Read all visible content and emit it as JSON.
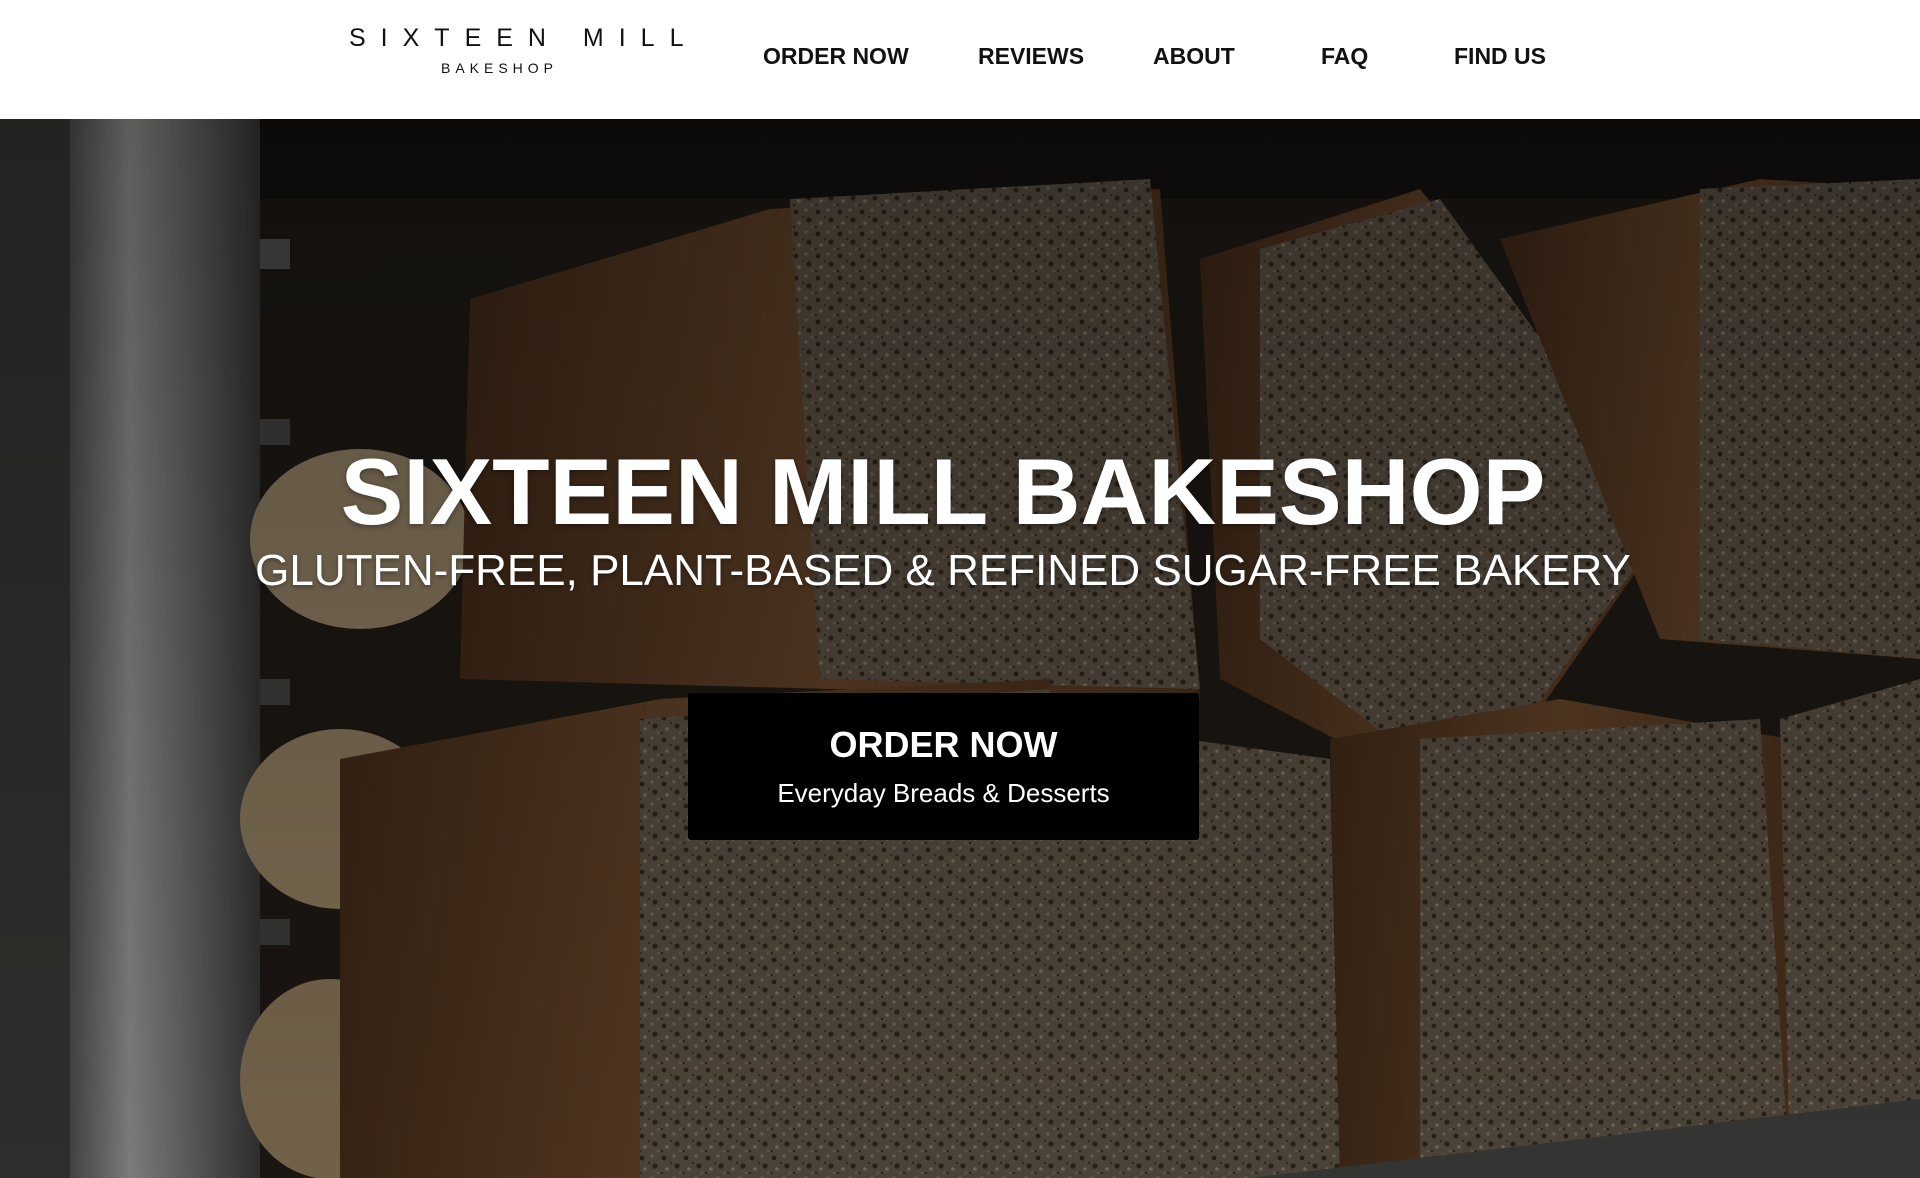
{
  "header": {
    "logo_main": "SIXTEEN MILL",
    "logo_sub": "BAKESHOP",
    "nav": {
      "order_now": "ORDER NOW",
      "reviews": "REVIEWS",
      "about": "ABOUT",
      "faq": "FAQ",
      "find_us": "FIND US"
    }
  },
  "hero": {
    "title": "SIXTEEN MILL BAKESHOP",
    "subtitle": "GLUTEN-FREE, PLANT-BASED & REFINED SUGAR-FREE BAKERY",
    "cta_label": "ORDER NOW",
    "cta_sub": "Everyday Breads & Desserts"
  },
  "colors": {
    "header_bg": "#ffffff",
    "nav_text": "#111111",
    "cta_bg": "#000000",
    "hero_text": "#ffffff"
  }
}
